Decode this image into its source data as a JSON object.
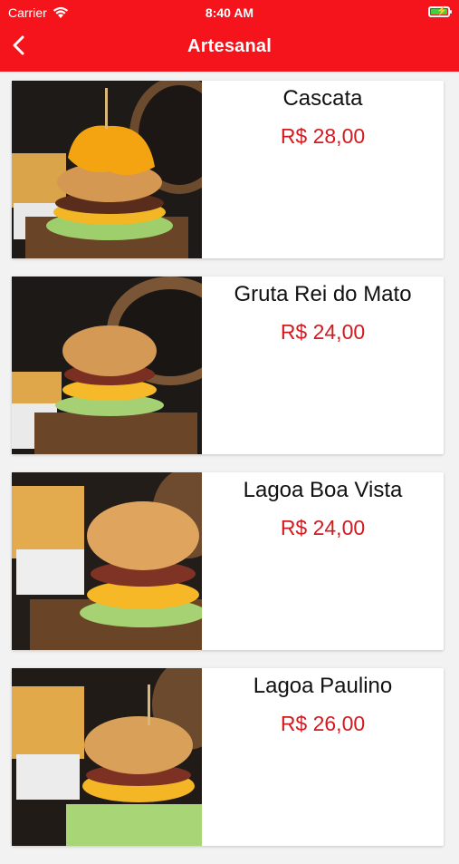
{
  "status_bar": {
    "carrier": "Carrier",
    "time": "8:40 AM"
  },
  "header": {
    "title": "Artesanal"
  },
  "colors": {
    "accent": "#f5141b",
    "price": "#d21a1f"
  },
  "products": [
    {
      "name": "Cascata",
      "price": "R$ 28,00",
      "image": "burger-cascata-photo"
    },
    {
      "name": "Gruta Rei do Mato",
      "price": "R$ 24,00",
      "image": "burger-gruta-rei-do-mato-photo"
    },
    {
      "name": "Lagoa Boa Vista",
      "price": "R$ 24,00",
      "image": "burger-lagoa-boa-vista-photo"
    },
    {
      "name": "Lagoa Paulino",
      "price": "R$ 26,00",
      "image": "burger-lagoa-paulino-photo"
    }
  ]
}
